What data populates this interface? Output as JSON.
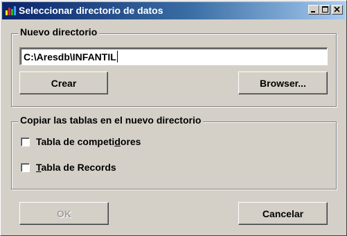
{
  "window": {
    "title": "Seleccionar directorio de datos",
    "controls": [
      "minimize-icon",
      "maximize-icon",
      "close-icon"
    ]
  },
  "nuevo_directorio": {
    "legend": "Nuevo directorio",
    "path_value": "C:\\Aresdb\\INFANTIL",
    "crear_label": "Crear",
    "browser_label": "Browser..."
  },
  "copiar_tablas": {
    "legend": "Copiar las tablas en el nuevo directorio",
    "items": [
      {
        "label_pre": "Tabla de competi",
        "label_ul": "d",
        "label_post": "ores",
        "checked": false
      },
      {
        "label_pre": "",
        "label_ul": "T",
        "label_post": "abla de Records",
        "checked": false
      }
    ]
  },
  "footer": {
    "ok_label": "OK",
    "ok_enabled": false,
    "cancelar_label": "Cancelar"
  },
  "colors": {
    "face": "#d4d0c8",
    "title_gradient_start": "#0a246a",
    "title_gradient_end": "#a6caf0"
  }
}
